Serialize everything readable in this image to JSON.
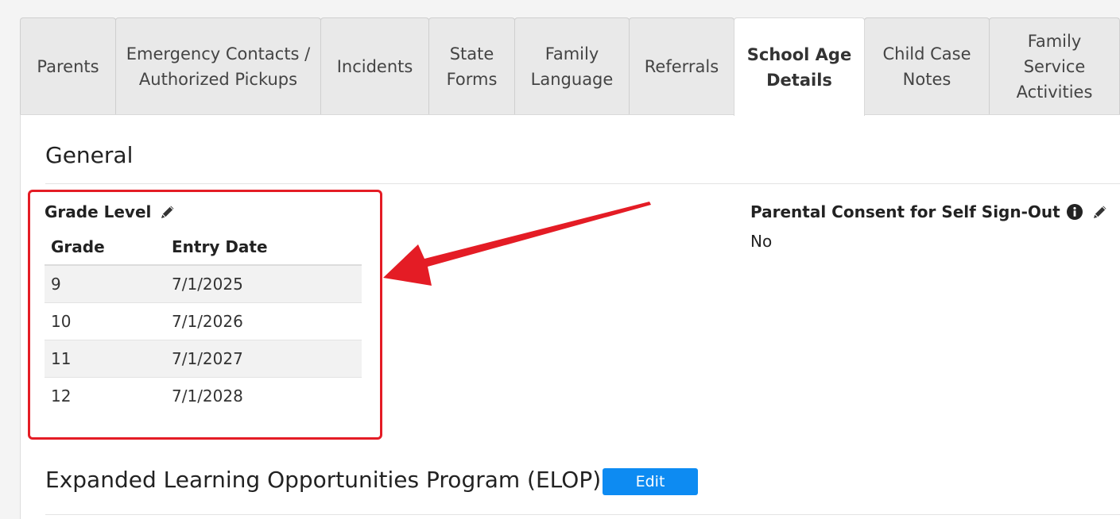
{
  "tabs": [
    {
      "label": "Parents",
      "active": false
    },
    {
      "label": "Emergency Contacts / Authorized Pickups",
      "active": false
    },
    {
      "label": "Incidents",
      "active": false
    },
    {
      "label": "State Forms",
      "active": false
    },
    {
      "label": "Family Language",
      "active": false
    },
    {
      "label": "Referrals",
      "active": false
    },
    {
      "label": "School Age Details",
      "active": true
    },
    {
      "label": "Child Case Notes",
      "active": false
    },
    {
      "label": "Family Service Activities",
      "active": false
    }
  ],
  "general": {
    "title": "General",
    "grade_level": {
      "label": "Grade Level",
      "columns": [
        "Grade",
        "Entry Date"
      ],
      "rows": [
        {
          "grade": "9",
          "entry_date": "7/1/2025"
        },
        {
          "grade": "10",
          "entry_date": "7/1/2026"
        },
        {
          "grade": "11",
          "entry_date": "7/1/2027"
        },
        {
          "grade": "12",
          "entry_date": "7/1/2028"
        }
      ]
    },
    "parental_consent": {
      "label": "Parental Consent for Self Sign-Out",
      "value": "No"
    }
  },
  "elop": {
    "title": "Expanded Learning Opportunities Program (ELOP)",
    "edit_label": "Edit"
  },
  "colors": {
    "highlight": "#e41c25",
    "button": "#0d8bf2"
  },
  "icons": {
    "edit": "pencil-icon",
    "info": "info-circle-icon"
  }
}
